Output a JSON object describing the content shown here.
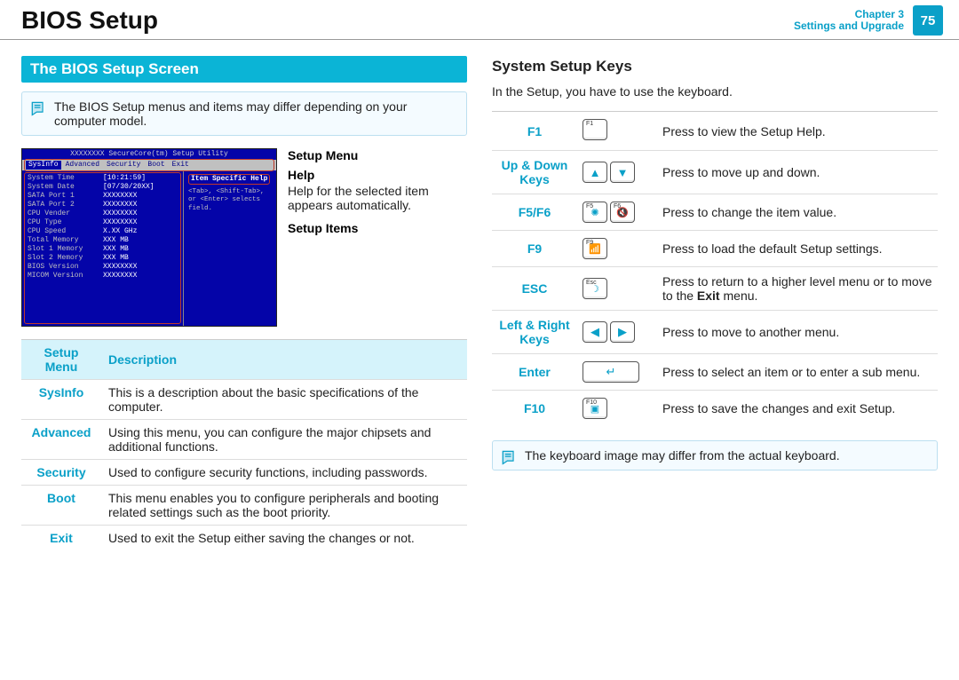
{
  "header": {
    "title": "BIOS Setup",
    "chapter_line1": "Chapter 3",
    "chapter_line2": "Settings and Upgrade",
    "page": "75"
  },
  "left": {
    "section_title": "The BIOS Setup Screen",
    "note": "The BIOS Setup menus and items may differ depending on your computer model.",
    "bios": {
      "window_title": "XXXXXXXX SecureCore(tm) Setup Utility",
      "tabs": [
        "SysInfo",
        "Advanced",
        "Security",
        "Boot",
        "Exit"
      ],
      "rows": [
        {
          "k": "System Time",
          "v": "[10:21:59]"
        },
        {
          "k": "System Date",
          "v": "[07/30/20XX]"
        },
        {
          "k": "",
          "v": ""
        },
        {
          "k": "SATA Port 1",
          "v": "XXXXXXXX"
        },
        {
          "k": "SATA Port 2",
          "v": "XXXXXXXX"
        },
        {
          "k": "",
          "v": ""
        },
        {
          "k": "CPU Vender",
          "v": "XXXXXXXX"
        },
        {
          "k": "CPU Type",
          "v": "XXXXXXXX"
        },
        {
          "k": "CPU Speed",
          "v": "X.XX GHz"
        },
        {
          "k": "",
          "v": ""
        },
        {
          "k": "Total Memory",
          "v": "XXX MB"
        },
        {
          "k": "  Slot 1 Memory",
          "v": "XXX MB"
        },
        {
          "k": "  Slot 2 Memory",
          "v": "XXX MB"
        },
        {
          "k": "",
          "v": ""
        },
        {
          "k": "BIOS Version",
          "v": "XXXXXXXX"
        },
        {
          "k": "MICOM Version",
          "v": "XXXXXXXX"
        }
      ],
      "help_title": "Item Specific Help",
      "help_body": "<Tab>, <Shift-Tab>, or <Enter> selects field."
    },
    "callouts": {
      "setup_menu": "Setup Menu",
      "help_title": "Help",
      "help_body": "Help for the selected item appears automatically.",
      "setup_items": "Setup Items"
    },
    "table": {
      "h1": "Setup Menu",
      "h2": "Description",
      "rows": [
        {
          "k": "SysInfo",
          "v": "This is a description about the basic specifications of the computer."
        },
        {
          "k": "Advanced",
          "v": "Using this menu, you can configure the major chipsets and additional functions."
        },
        {
          "k": "Security",
          "v": "Used to configure security functions, including passwords."
        },
        {
          "k": "Boot",
          "v": "This menu enables you to configure peripherals and booting related settings such as the boot priority."
        },
        {
          "k": "Exit",
          "v": "Used to exit the Setup either saving the changes or not."
        }
      ]
    }
  },
  "right": {
    "heading": "System Setup Keys",
    "intro": "In the Setup, you have to use the keyboard.",
    "rows": [
      {
        "label": "F1",
        "keys": [
          {
            "tl": "F1",
            "icon": ""
          }
        ],
        "desc": "Press to view the Setup Help."
      },
      {
        "label": "Up & Down Keys",
        "keys": [
          {
            "tl": "",
            "icon": "▲"
          },
          {
            "tl": "",
            "icon": "▼"
          }
        ],
        "desc": "Press to move up and down."
      },
      {
        "label": "F5/F6",
        "keys": [
          {
            "tl": "F5",
            "icon": "✺"
          },
          {
            "tl": "F6",
            "icon": "🔇"
          }
        ],
        "desc": "Press to change the item value."
      },
      {
        "label": "F9",
        "keys": [
          {
            "tl": "F9",
            "icon": "📶"
          }
        ],
        "desc": "Press to load the default Setup settings."
      },
      {
        "label": "ESC",
        "keys": [
          {
            "tl": "Esc",
            "icon": "☽"
          }
        ],
        "desc_html": "Press to return to a higher level menu or to move to the <b>Exit</b> menu."
      },
      {
        "label": "Left & Right Keys",
        "keys": [
          {
            "tl": "",
            "icon": "◀"
          },
          {
            "tl": "",
            "icon": "▶"
          }
        ],
        "desc": "Press to move to another menu."
      },
      {
        "label": "Enter",
        "keys": [
          {
            "tl": "",
            "icon": "↵",
            "wide": true
          }
        ],
        "desc": "Press to select an item or to enter a sub menu."
      },
      {
        "label": "F10",
        "keys": [
          {
            "tl": "F10",
            "icon": "▣"
          }
        ],
        "desc": "Press to save the changes and exit Setup."
      }
    ],
    "note": "The keyboard image may differ from the actual keyboard."
  }
}
